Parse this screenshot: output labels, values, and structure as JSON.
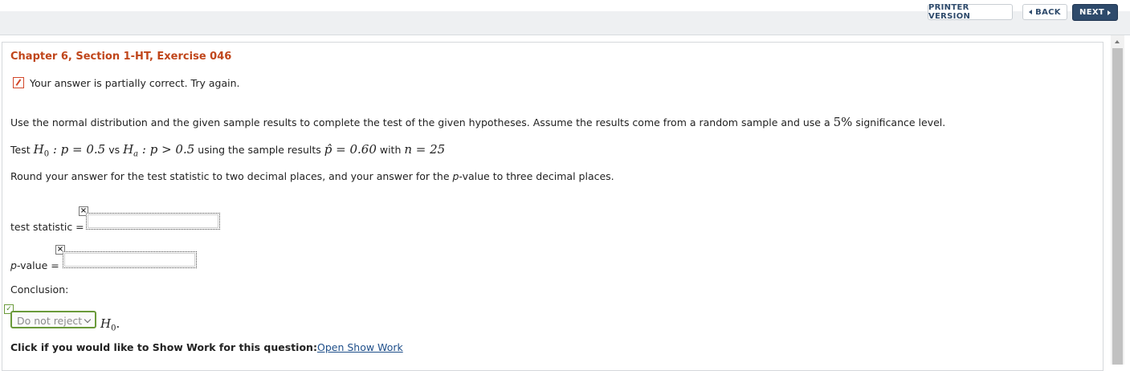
{
  "toolbar": {
    "printer_label": "PRINTER VERSION",
    "back_label": "BACK",
    "next_label": "NEXT"
  },
  "question": {
    "title": "Chapter 6, Section 1-HT, Exercise 046",
    "feedback": "Your answer is partially correct.  Try again.",
    "instructions_part1": "Use the normal distribution and the given sample results to complete the test of the given hypotheses. Assume the results come from a random sample and use a ",
    "significance": "5%",
    "instructions_part2": " significance level.",
    "test_prefix": "Test ",
    "h0_sym": "H",
    "h0_sub": "0",
    "h0_expr": " : p = 0.5",
    "vs": " vs ",
    "ha_sym": "H",
    "ha_sub": "a",
    "ha_expr": " : p > 0.5",
    "using_text": " using the sample results ",
    "phat_expr": "p̂ = 0.60",
    "with_text": " with ",
    "n_expr": "n = 25",
    "round_part1": "Round your answer for the test statistic to two decimal places, and your answer for the ",
    "round_p": "p",
    "round_part2": "-value to three decimal places."
  },
  "answers": {
    "test_statistic_label": "test statistic  =",
    "test_statistic_value": "",
    "pvalue_label_p": "p",
    "pvalue_label_rest": "-value  =",
    "pvalue_value": "",
    "conclusion_label": "Conclusion:",
    "conclusion_selected": "Do not reject",
    "conclusion_sym": "H",
    "conclusion_sub": "0",
    "conclusion_end": "."
  },
  "show_work": {
    "prompt": "Click if you would like to Show Work for this question:",
    "link": "Open Show Work"
  }
}
